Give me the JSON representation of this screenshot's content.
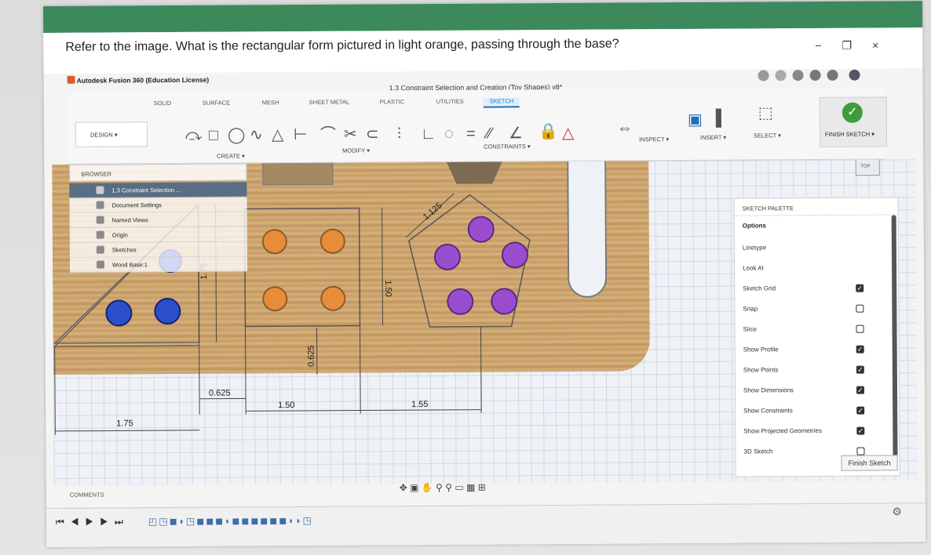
{
  "question": "Refer to the image. What is the rectangular form pictured in light orange, passing through the base?",
  "window_controls": [
    "−",
    "❐",
    "×"
  ],
  "app": {
    "title": "Autodesk Fusion 360 (Education License)",
    "doc_title": "1.3 Constraint Selection and Creation (Toy Shapes) v8*"
  },
  "ribbon": {
    "tabs": [
      "SOLID",
      "SURFACE",
      "MESH",
      "SHEET METAL",
      "PLASTIC",
      "UTILITIES",
      "SKETCH"
    ],
    "design_label": "DESIGN ▾",
    "groups": [
      "CREATE ▾",
      "MODIFY ▾",
      "CONSTRAINTS ▾",
      "INSPECT ▾",
      "INSERT ▾",
      "SELECT ▾",
      "FINISH SKETCH ▾"
    ]
  },
  "browser": {
    "header": "BROWSER",
    "root": "1.3 Constraint Selection ...",
    "items": [
      "Document Settings",
      "Named Views",
      "Origin",
      "Sketches",
      "Wood Base:1"
    ]
  },
  "dimensions": {
    "d1": "1.75",
    "d2": "1.50",
    "d3": "1.125",
    "d4": "0.625",
    "d5": "0.625",
    "d6": "1.50",
    "d7": "1.55",
    "d8": "1.75"
  },
  "view_cube": "TOP",
  "palette": {
    "header": "SKETCH PALETTE",
    "options_label": "Options",
    "linetype": "Linetype",
    "look_at": "Look At",
    "options": [
      {
        "label": "Sketch Grid",
        "checked": true
      },
      {
        "label": "Snap",
        "checked": false
      },
      {
        "label": "Slice",
        "checked": false
      },
      {
        "label": "Show Profile",
        "checked": true
      },
      {
        "label": "Show Points",
        "checked": true
      },
      {
        "label": "Show Dimensions",
        "checked": true
      },
      {
        "label": "Show Constraints",
        "checked": true
      },
      {
        "label": "Show Projected Geometries",
        "checked": true
      },
      {
        "label": "3D Sketch",
        "checked": false
      }
    ],
    "finish_button": "Finish Sketch"
  },
  "comments_label": "COMMENTS",
  "colors": {
    "orange_hole": "#e88c3a",
    "purple_hole": "#9a4ccf",
    "blue_hole": "#2c4fc9",
    "accent": "#1a74c6"
  }
}
